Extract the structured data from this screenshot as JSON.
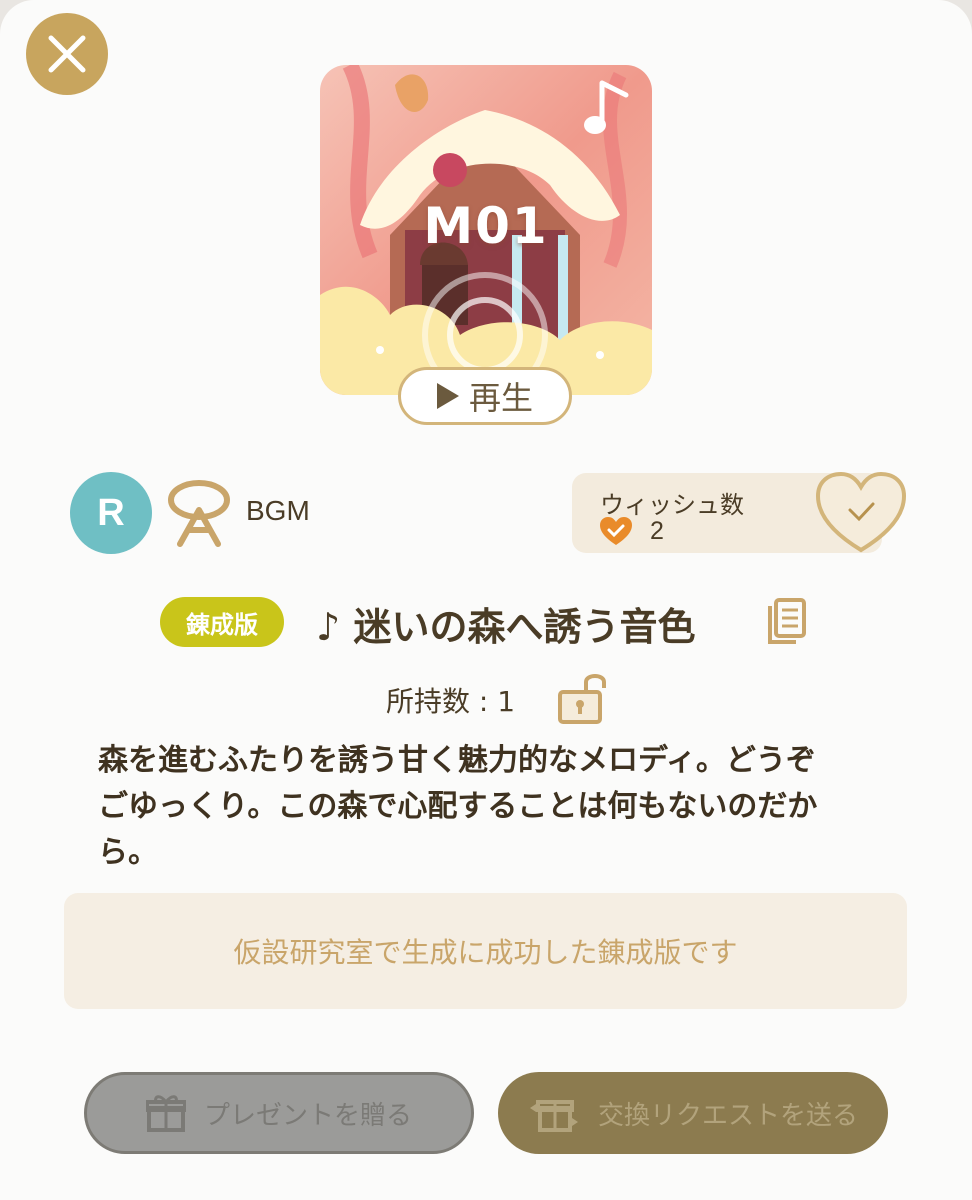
{
  "colors": {
    "accent_gold": "#c8a55e",
    "rarity_teal": "#6fbfc4",
    "badge_yellow": "#c9c51a",
    "text_brown": "#4a3c26",
    "heart_orange": "#e98b2a"
  },
  "header": {
    "close_icon": "close-icon"
  },
  "item_art": {
    "code": "M01",
    "play_label": "再生"
  },
  "meta": {
    "rarity": "R",
    "category_label": "BGM",
    "wish": {
      "label": "ウィッシュ数",
      "count": "2"
    }
  },
  "item": {
    "badge": "錬成版",
    "title": "♪ 迷いの森へ誘う音色",
    "owned_label": "所持数 : 1",
    "description": "森を進むふたりを誘う甘く魅力的なメロディ。どうぞごゆっくり。この森で心配することは何もないのだから。"
  },
  "info": {
    "message": "仮設研究室で生成に成功した錬成版です"
  },
  "actions": {
    "gift_label": "プレゼントを贈る",
    "trade_label": "交換リクエストを送る"
  }
}
